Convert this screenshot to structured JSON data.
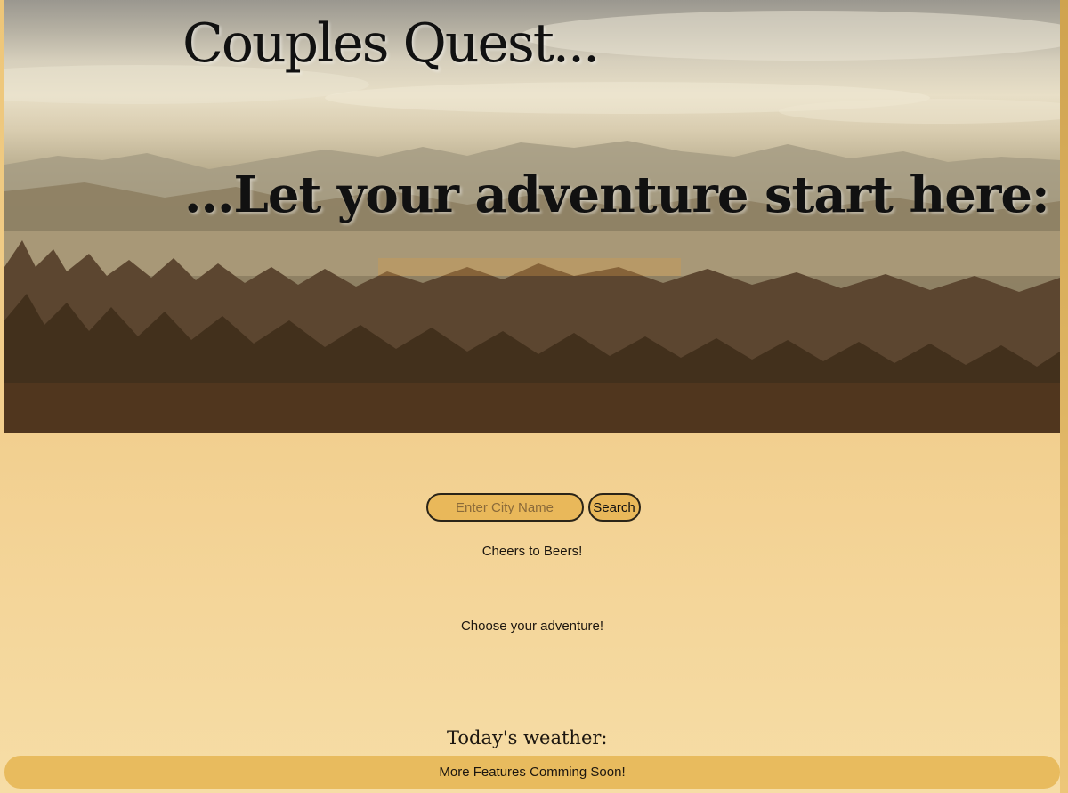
{
  "hero": {
    "title": "Couples Quest...",
    "subtitle": "...Let your adventure start here:"
  },
  "search": {
    "placeholder": "Enter City Name",
    "value": "",
    "button_label": "Search"
  },
  "content": {
    "beers_text": "Cheers to Beers!",
    "adventure_text": "Choose your adventure!",
    "weather_label": "Today's weather:"
  },
  "footer": {
    "text": "More Features Comming Soon!"
  },
  "colors": {
    "page_background": "#f2cf8f",
    "accent": "#e8bb5e",
    "text": "#1c160f"
  }
}
